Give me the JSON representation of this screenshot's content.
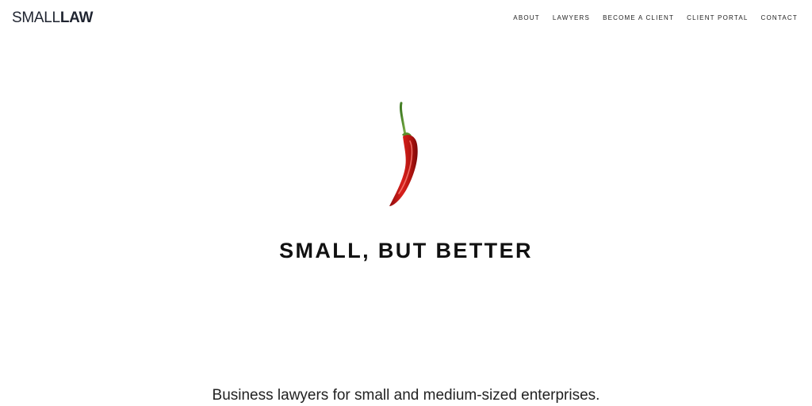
{
  "header": {
    "logo_light": "SMALL",
    "logo_bold": "LAW",
    "nav": [
      {
        "label": "ABOUT"
      },
      {
        "label": "LAWYERS"
      },
      {
        "label": "BECOME A CLIENT"
      },
      {
        "label": "CLIENT PORTAL"
      },
      {
        "label": "CONTACT"
      }
    ]
  },
  "hero": {
    "image_icon": "chili-pepper-icon",
    "headline": "SMALL, BUT BETTER",
    "subline": "Business lawyers for small and medium-sized enterprises."
  },
  "colors": {
    "logo": "#1f2430",
    "text": "#111111",
    "pepper_red": "#d11a1a",
    "stem_green": "#4a8a2a"
  }
}
